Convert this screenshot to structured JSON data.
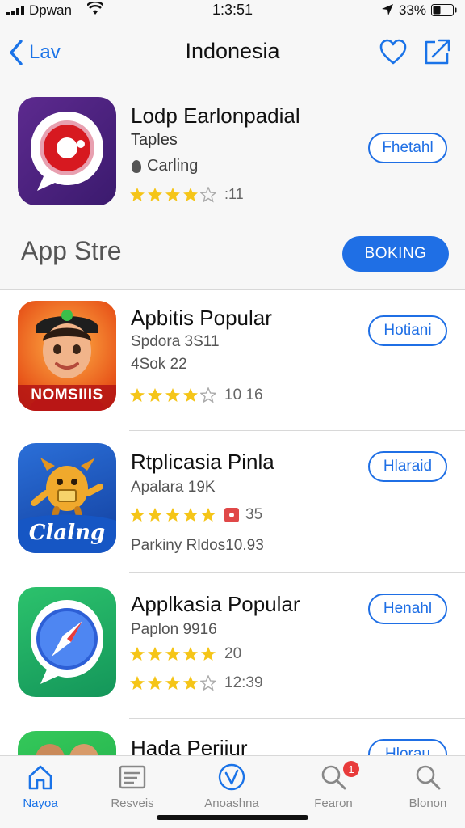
{
  "status_bar": {
    "carrier": "Dpwan",
    "time": "1:3:51",
    "battery": "33%"
  },
  "nav": {
    "back_label": "Lav",
    "title": "Indonesia"
  },
  "featured": {
    "name": "Lodp Earlonpadial",
    "subtitle": "Taples",
    "category": "Carling",
    "rating_count": ":11",
    "stars": 4,
    "get_label": "Fhetahl",
    "store_title": "App Stre",
    "booking_label": "BOKING"
  },
  "apps": [
    {
      "name": "Apbitis Popular",
      "line1": "Spdora 3S11",
      "line2": "4Sok 22",
      "stars": 4,
      "rating_text": "10 16",
      "button_label": "Hotiani",
      "icon_text": "NOMSIIIS"
    },
    {
      "name": "Rtplicasia Pinla",
      "line1": "Apalara 19K",
      "stars": 5,
      "rating_text": "35",
      "line3": "Parkiny Rldos10.93",
      "button_label": "Hlaraid",
      "icon_text": "Clalng"
    },
    {
      "name": "Applkasia Popular",
      "line1": "Paplon 9916",
      "stars": 5,
      "rating_text": "20",
      "stars2": 4,
      "rating_text2": "12:39",
      "button_label": "Henahl"
    },
    {
      "name": "Hada Periiur",
      "button_label": "Hlorau"
    }
  ],
  "tabs": [
    {
      "label": "Nayoa",
      "icon": "home-icon",
      "active": true
    },
    {
      "label": "Resveis",
      "icon": "list-icon"
    },
    {
      "label": "Anoashna",
      "icon": "compass-icon"
    },
    {
      "label": "Fearon",
      "icon": "search-icon",
      "badge": "1"
    },
    {
      "label": "Blonon",
      "icon": "search-icon"
    }
  ],
  "colors": {
    "accent": "#1f6fe5",
    "star": "#f5c518",
    "badge": "#e83b3b"
  }
}
